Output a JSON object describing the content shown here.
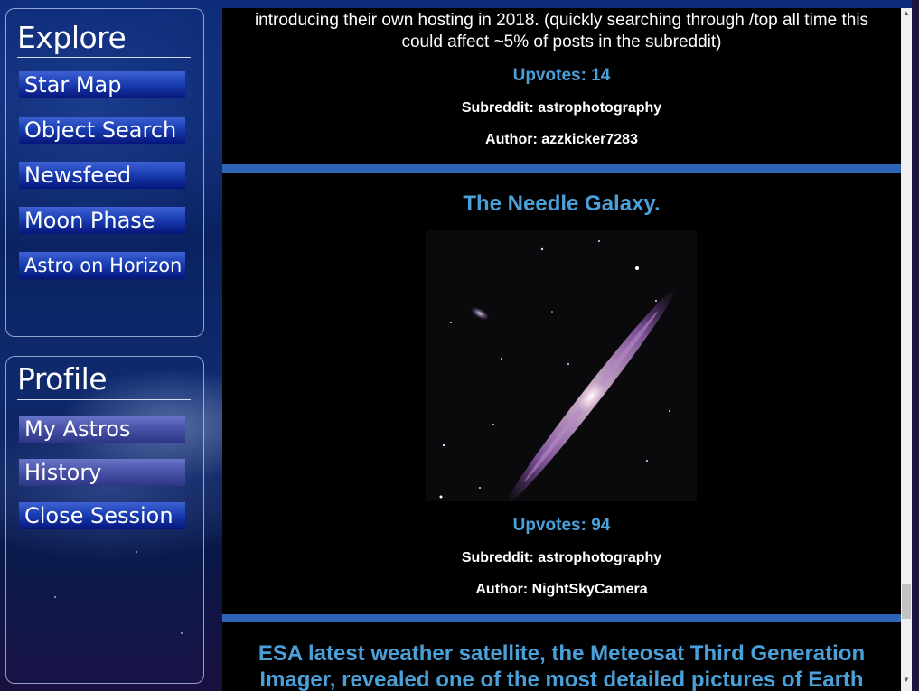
{
  "sidebar": {
    "explore": {
      "title": "Explore",
      "items": [
        {
          "label": "Star Map"
        },
        {
          "label": "Object Search"
        },
        {
          "label": "Newsfeed"
        },
        {
          "label": "Moon Phase"
        },
        {
          "label": "Astro on Horizon"
        }
      ]
    },
    "profile": {
      "title": "Profile",
      "items": [
        {
          "label": "My Astros"
        },
        {
          "label": "History"
        },
        {
          "label": "Close Session"
        }
      ]
    }
  },
  "feed": {
    "posts": [
      {
        "body_line_1": "introducing their own hosting in 2018. (quickly searching through /top all time this",
        "body_line_2": "could affect ~5% of posts in the subreddit)",
        "upvotes": "Upvotes: 14",
        "subreddit": "Subreddit: astrophotography",
        "author": "Author: azzkicker7283"
      },
      {
        "title": "The Needle Galaxy.",
        "image_alt": "Needle Galaxy photograph",
        "upvotes": "Upvotes: 94",
        "subreddit": "Subreddit: astrophotography",
        "author": "Author: NightSkyCamera"
      },
      {
        "title_line_1": "ESA latest weather satellite, the Meteosat Third Generation",
        "title_line_2": "Imager, revealed one of the most detailed pictures of Earth"
      }
    ]
  },
  "colors": {
    "accent_title": "#4aa0d8",
    "divider": "#2e64b8",
    "feed_background": "#000000"
  }
}
